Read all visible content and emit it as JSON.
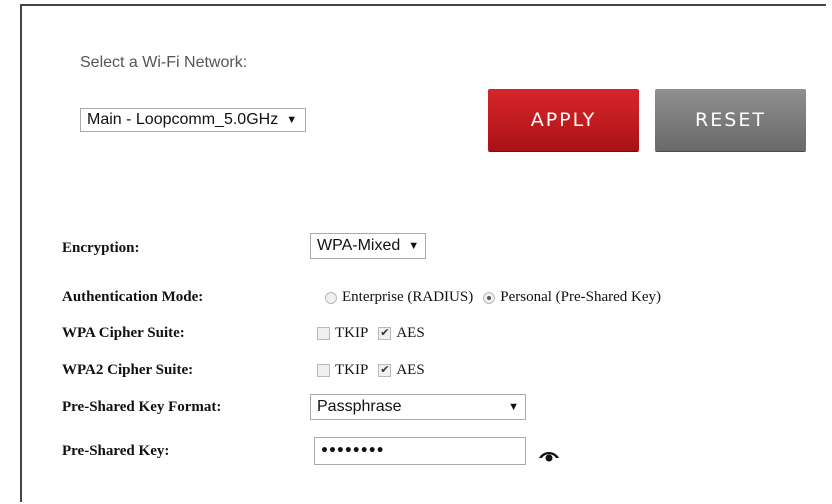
{
  "network": {
    "label": "Select a Wi-Fi Network:",
    "selected": "Main - Loopcomm_5.0GHz"
  },
  "buttons": {
    "apply": "APPLY",
    "reset": "RESET"
  },
  "form": {
    "encryption": {
      "label": "Encryption:",
      "value": "WPA-Mixed"
    },
    "auth_mode": {
      "label": "Authentication Mode:",
      "options": [
        "Enterprise (RADIUS)",
        "Personal (Pre-Shared Key)"
      ],
      "selected": "Personal (Pre-Shared Key)"
    },
    "wpa_cipher": {
      "label": "WPA Cipher Suite:",
      "tkip": "TKIP",
      "aes": "AES",
      "tkip_checked": false,
      "aes_checked": true
    },
    "wpa2_cipher": {
      "label": "WPA2 Cipher Suite:",
      "tkip": "TKIP",
      "aes": "AES",
      "tkip_checked": false,
      "aes_checked": true
    },
    "psk_format": {
      "label": "Pre-Shared Key Format:",
      "value": "Passphrase"
    },
    "psk": {
      "label": "Pre-Shared Key:",
      "masked_value": "••••••••"
    }
  },
  "icons": {
    "show_password": "eye-icon"
  },
  "colors": {
    "apply": "#c01b1f",
    "reset": "#7a7a7a"
  }
}
